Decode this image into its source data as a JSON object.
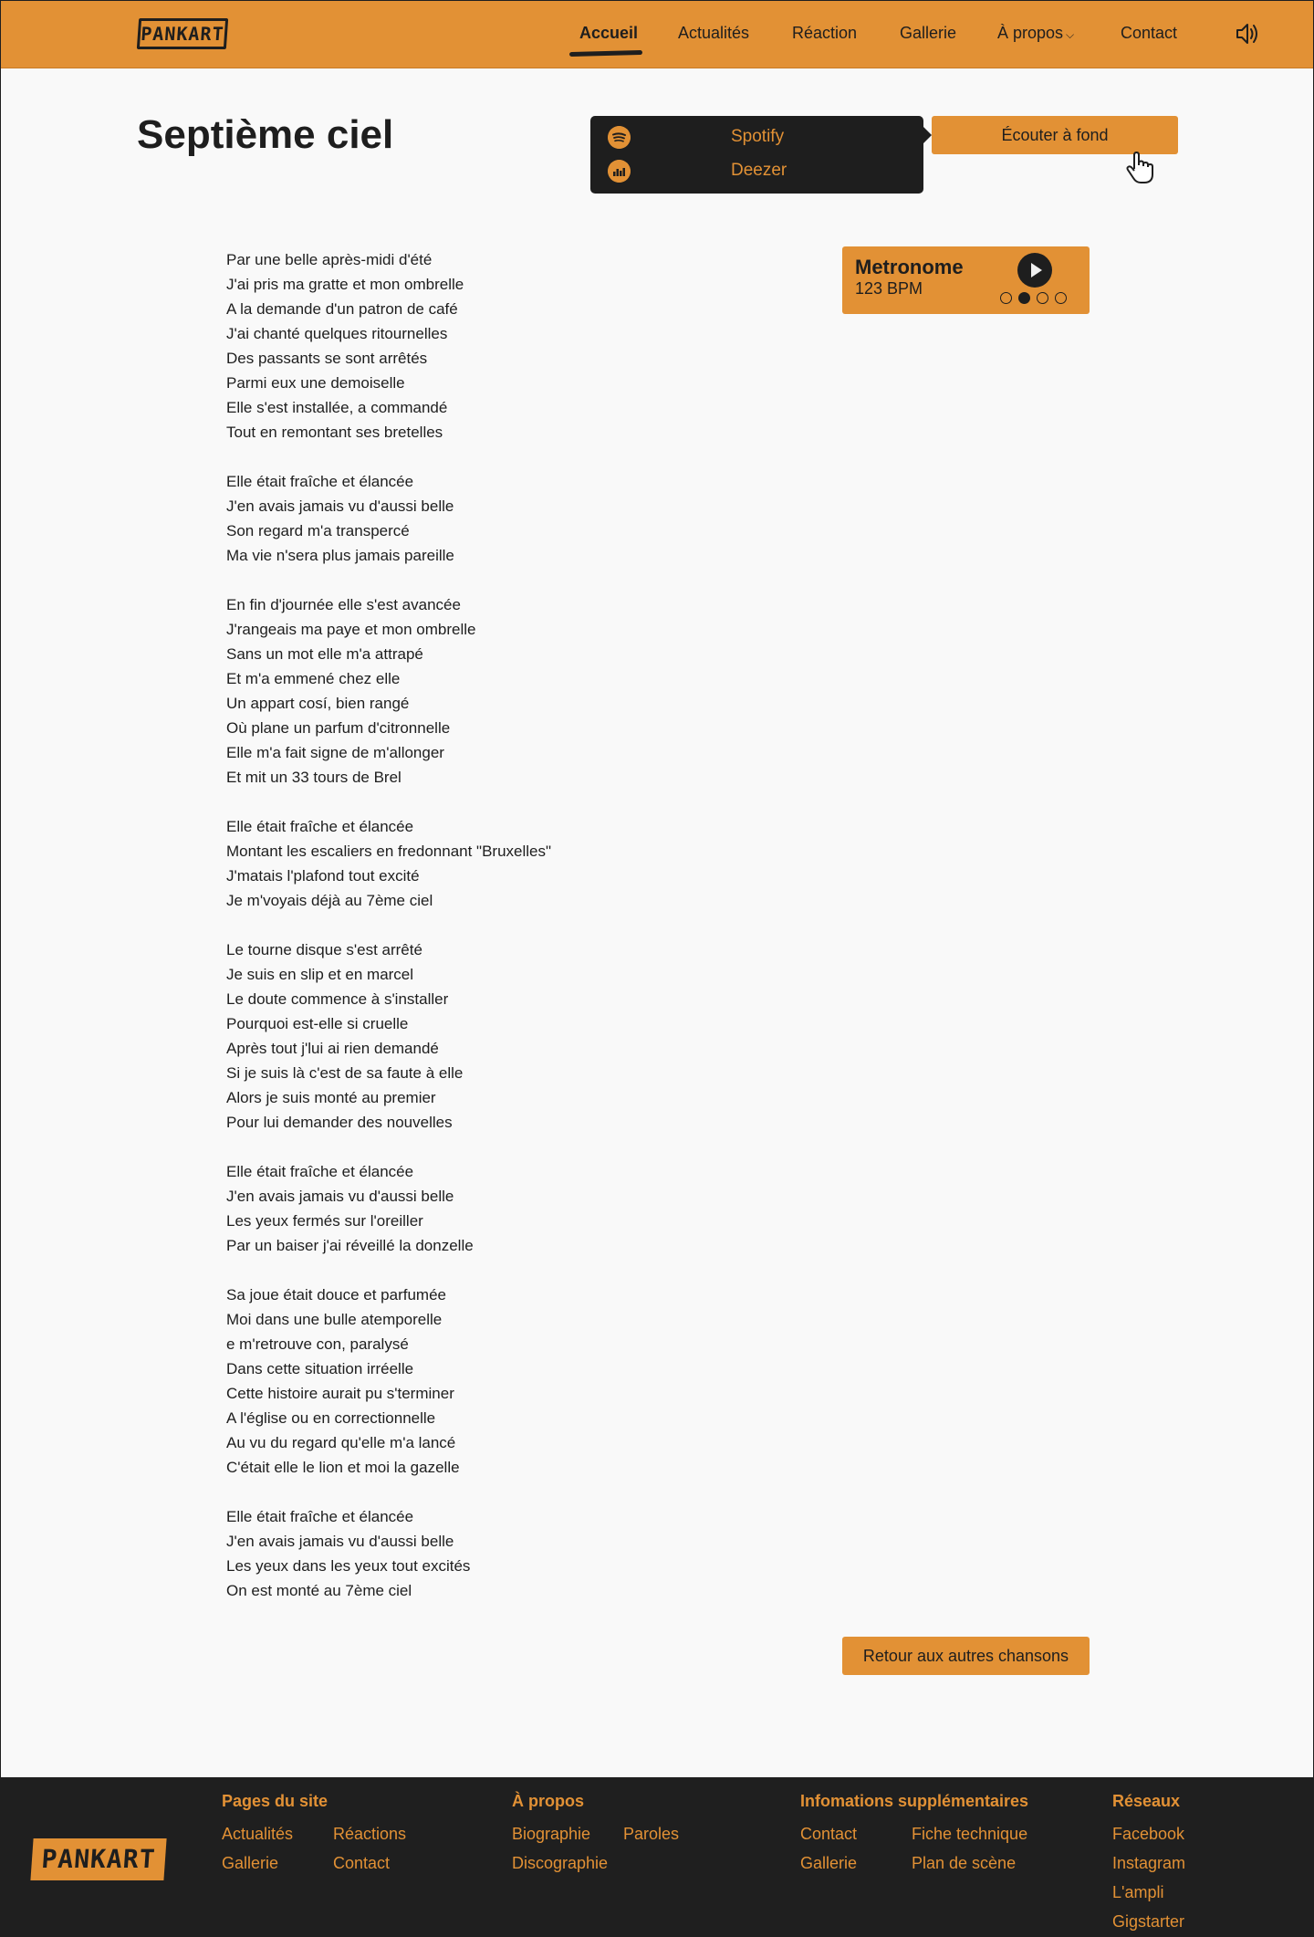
{
  "header": {
    "logo_text": "PANKART",
    "nav": [
      {
        "label": "Accueil",
        "active": true
      },
      {
        "label": "Actualités"
      },
      {
        "label": "Réaction"
      },
      {
        "label": "Gallerie"
      },
      {
        "label": "À propos"
      },
      {
        "label": "Contact"
      }
    ],
    "sound_icon": "speaker-icon"
  },
  "song": {
    "title": "Septième ciel",
    "streaming": [
      {
        "label": "Spotify",
        "icon": "spotify-icon"
      },
      {
        "label": "Deezer",
        "icon": "deezer-icon"
      }
    ],
    "listen_button": "Écouter à fond",
    "metronome": {
      "title": "Metronome",
      "bpm": "123 BPM",
      "beats": 4,
      "active_beat": 2
    },
    "back_button": "Retour aux autres chansons",
    "lyrics": [
      [
        "Par une belle après-midi d'été",
        "J'ai pris ma gratte et mon ombrelle",
        "A la demande d'un patron de café",
        "J'ai chanté quelques ritournelles",
        "Des passants se sont arrêtés",
        "Parmi eux une demoiselle",
        "Elle s'est installée, a commandé",
        "Tout en remontant ses bretelles"
      ],
      [
        "Elle était fraîche et élancée",
        "J'en avais jamais vu d'aussi belle",
        "Son regard m'a transpercé",
        "Ma vie n'sera plus jamais pareille"
      ],
      [
        "En fin d'journée elle s'est avancée",
        "J'rangeais ma paye et mon ombrelle",
        "Sans un mot elle m'a attrapé",
        "Et m'a emmené chez elle",
        "Un appart cosí, bien rangé",
        "Où plane un parfum d'citronnelle",
        "Elle m'a fait signe de m'allonger",
        "Et mit un 33 tours de Brel"
      ],
      [
        "Elle était fraîche et élancée",
        "Montant les escaliers en fredonnant \"Bruxelles\"",
        "J'matais l'plafond tout excité",
        "Je m'voyais déjà au 7ème ciel"
      ],
      [
        "Le tourne disque s'est arrêté",
        "Je suis en slip et en marcel",
        "Le doute commence à s'installer",
        "Pourquoi est-elle si cruelle",
        "Après tout j'lui ai rien demandé",
        "Si je suis là c'est de sa faute à elle",
        "Alors je suis monté au premier",
        "Pour lui demander des nouvelles"
      ],
      [
        "Elle était fraîche et élancée",
        "J'en avais jamais vu d'aussi belle",
        "Les yeux fermés sur l'oreiller",
        "Par un baiser j'ai réveillé la donzelle"
      ],
      [
        "Sa joue était douce et parfumée",
        "Moi dans une bulle atemporelle",
        "e m'retrouve con, paralysé",
        "Dans cette situation irréelle",
        "Cette histoire aurait pu s'terminer",
        "A l'église ou en correctionnelle",
        "Au vu du regard qu'elle m'a lancé",
        "C'était elle le lion et moi la gazelle"
      ],
      [
        "Elle était fraîche et élancée",
        "J'en avais jamais vu d'aussi belle",
        "Les yeux dans les yeux tout excités",
        "On est monté au 7ème ciel"
      ]
    ]
  },
  "footer": {
    "logo_text": "PANKART",
    "columns": [
      {
        "title": "Pages du site",
        "links": [
          "Actualités",
          "Réactions",
          "Gallerie",
          "Contact"
        ]
      },
      {
        "title": "À propos",
        "links": [
          "Biographie",
          "Paroles",
          "Discographie"
        ]
      },
      {
        "title": "Infomations supplémentaires",
        "links": [
          "Contact",
          "Fiche technique",
          "Gallerie",
          "Plan de scène"
        ]
      },
      {
        "title": "Réseaux",
        "links": [
          "Facebook",
          "Instagram",
          "L'ampli",
          "Gigstarter"
        ]
      }
    ]
  },
  "colors": {
    "accent": "#e29135",
    "dark": "#1e1e1e",
    "background": "#f9f9f9"
  }
}
